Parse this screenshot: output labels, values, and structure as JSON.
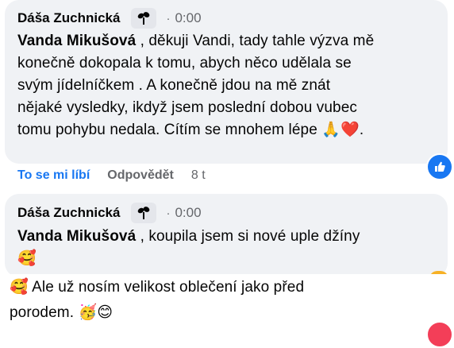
{
  "comment1": {
    "author": "Dáša Zuchnická",
    "time": "0:00",
    "mention": "Vanda Mikušová",
    "text_lines": [
      " , děkuji Vandi, tady tahle výzva mě",
      "konečně dokopala k tomu, abych něco udělala se",
      "svým jídelníčkem . A konečně jdou na mě znát",
      "nějaké vysledky, ikdyž jsem poslední dobou vubec",
      "tomu pohybu nedala. Cítím se mnohem lépe"
    ],
    "emojis": [
      "🙏",
      "❤️"
    ],
    "trailing": "."
  },
  "actions": {
    "like": "To se mi líbí",
    "reply": "Odpovědět",
    "age": "8 t"
  },
  "comment2": {
    "author": "Dáša Zuchnická",
    "time": "0:00",
    "mention": "Vanda Mikušová",
    "text": " , koupila jsem si nové uple džíny",
    "emoji": "🥰"
  },
  "comment3": {
    "lead_emoji": "🥰",
    "line1": " Ale už nosím velikost oblečení jako před",
    "line2": "porodem.",
    "emojis": [
      "🥳",
      "😊"
    ]
  },
  "reactions": {
    "like_color": "#1877f2",
    "love_color": "#f33e58"
  }
}
